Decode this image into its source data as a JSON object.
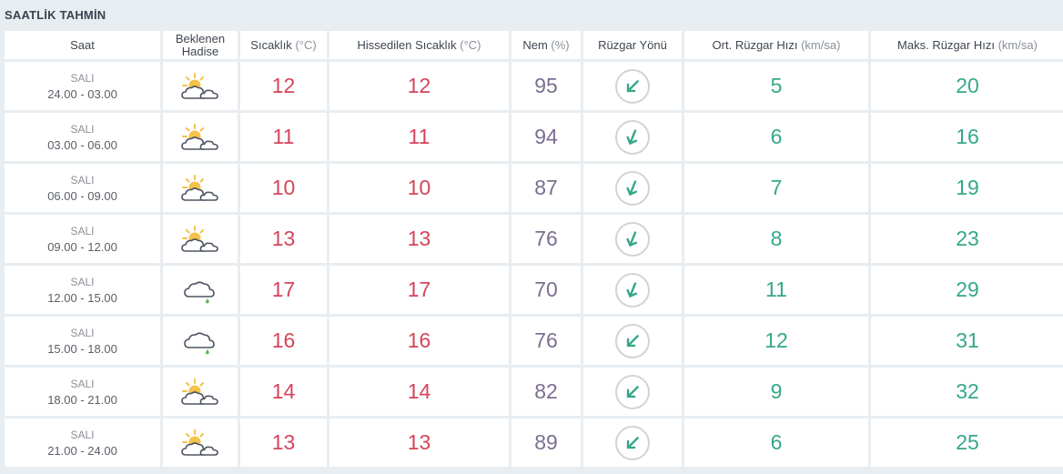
{
  "title": "SAATLİK TAHMİN",
  "headers": {
    "saat": "Saat",
    "hadise_line1": "Beklenen",
    "hadise_line2": "Hadise",
    "sicaklik": "Sıcaklık",
    "sicaklik_unit": "(°C)",
    "hissedilen": "Hissedilen Sıcaklık",
    "hissedilen_unit": "(°C)",
    "nem": "Nem",
    "nem_unit": "(%)",
    "ruzgar_yonu": "Rüzgar Yönü",
    "ort_ruzgar": "Ort. Rüzgar Hızı",
    "ort_ruzgar_unit": "(km/sa)",
    "maks_ruzgar": "Maks. Rüzgar Hızı",
    "maks_ruzgar_unit": "(km/sa)"
  },
  "colors": {
    "temperature": "#d4455b",
    "humidity": "#7c6e91",
    "wind": "#35a889",
    "sun": "#f5c24a",
    "rain": "#5cb85c"
  },
  "rows": [
    {
      "day": "SALI",
      "time": "24.00 - 03.00",
      "icon": "partly-cloudy-icon",
      "temp": "12",
      "feels": "12",
      "humidity": "95",
      "wind_dir_icon": "arrow-southwest-icon",
      "avg_wind": "5",
      "max_wind": "20"
    },
    {
      "day": "SALI",
      "time": "03.00 - 06.00",
      "icon": "partly-cloudy-icon",
      "temp": "11",
      "feels": "11",
      "humidity": "94",
      "wind_dir_icon": "arrow-south-southwest-icon",
      "avg_wind": "6",
      "max_wind": "16"
    },
    {
      "day": "SALI",
      "time": "06.00 - 09.00",
      "icon": "partly-cloudy-icon",
      "temp": "10",
      "feels": "10",
      "humidity": "87",
      "wind_dir_icon": "arrow-south-southwest-icon",
      "avg_wind": "7",
      "max_wind": "19"
    },
    {
      "day": "SALI",
      "time": "09.00 - 12.00",
      "icon": "partly-cloudy-icon",
      "temp": "13",
      "feels": "13",
      "humidity": "76",
      "wind_dir_icon": "arrow-south-southwest-icon",
      "avg_wind": "8",
      "max_wind": "23"
    },
    {
      "day": "SALI",
      "time": "12.00 - 15.00",
      "icon": "cloud-rain-icon",
      "temp": "17",
      "feels": "17",
      "humidity": "70",
      "wind_dir_icon": "arrow-south-southwest-icon",
      "avg_wind": "11",
      "max_wind": "29"
    },
    {
      "day": "SALI",
      "time": "15.00 - 18.00",
      "icon": "cloud-rain-icon",
      "temp": "16",
      "feels": "16",
      "humidity": "76",
      "wind_dir_icon": "arrow-southwest-icon",
      "avg_wind": "12",
      "max_wind": "31"
    },
    {
      "day": "SALI",
      "time": "18.00 - 21.00",
      "icon": "partly-cloudy-icon",
      "temp": "14",
      "feels": "14",
      "humidity": "82",
      "wind_dir_icon": "arrow-southwest-icon",
      "avg_wind": "9",
      "max_wind": "32"
    },
    {
      "day": "SALI",
      "time": "21.00 - 24.00",
      "icon": "partly-cloudy-icon",
      "temp": "13",
      "feels": "13",
      "humidity": "89",
      "wind_dir_icon": "arrow-southwest-icon",
      "avg_wind": "6",
      "max_wind": "25"
    }
  ]
}
